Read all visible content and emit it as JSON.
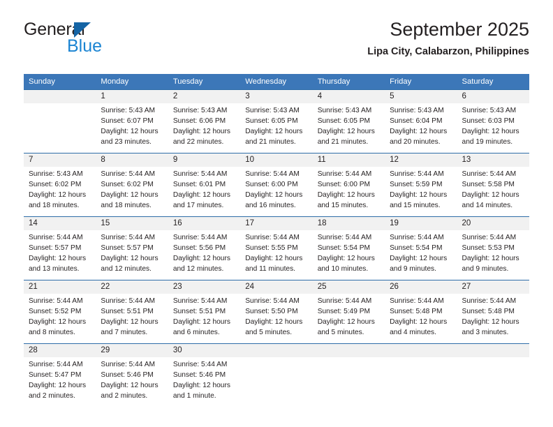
{
  "brand": {
    "name_dark": "General",
    "name_blue": "Blue",
    "accent_blue": "#1b84d2",
    "triangle_blue": "#1464a5"
  },
  "header": {
    "title": "September 2025",
    "subtitle": "Lipa City, Calabarzon, Philippines"
  },
  "calendar": {
    "header_bg": "#3c77b8",
    "daynum_bg": "#f1f1f1",
    "weekdays": [
      "Sunday",
      "Monday",
      "Tuesday",
      "Wednesday",
      "Thursday",
      "Friday",
      "Saturday"
    ],
    "weeks": [
      [
        {
          "day": "",
          "sunrise": "",
          "sunset": "",
          "daylight1": "",
          "daylight2": ""
        },
        {
          "day": "1",
          "sunrise": "Sunrise: 5:43 AM",
          "sunset": "Sunset: 6:07 PM",
          "daylight1": "Daylight: 12 hours",
          "daylight2": "and 23 minutes."
        },
        {
          "day": "2",
          "sunrise": "Sunrise: 5:43 AM",
          "sunset": "Sunset: 6:06 PM",
          "daylight1": "Daylight: 12 hours",
          "daylight2": "and 22 minutes."
        },
        {
          "day": "3",
          "sunrise": "Sunrise: 5:43 AM",
          "sunset": "Sunset: 6:05 PM",
          "daylight1": "Daylight: 12 hours",
          "daylight2": "and 21 minutes."
        },
        {
          "day": "4",
          "sunrise": "Sunrise: 5:43 AM",
          "sunset": "Sunset: 6:05 PM",
          "daylight1": "Daylight: 12 hours",
          "daylight2": "and 21 minutes."
        },
        {
          "day": "5",
          "sunrise": "Sunrise: 5:43 AM",
          "sunset": "Sunset: 6:04 PM",
          "daylight1": "Daylight: 12 hours",
          "daylight2": "and 20 minutes."
        },
        {
          "day": "6",
          "sunrise": "Sunrise: 5:43 AM",
          "sunset": "Sunset: 6:03 PM",
          "daylight1": "Daylight: 12 hours",
          "daylight2": "and 19 minutes."
        }
      ],
      [
        {
          "day": "7",
          "sunrise": "Sunrise: 5:43 AM",
          "sunset": "Sunset: 6:02 PM",
          "daylight1": "Daylight: 12 hours",
          "daylight2": "and 18 minutes."
        },
        {
          "day": "8",
          "sunrise": "Sunrise: 5:44 AM",
          "sunset": "Sunset: 6:02 PM",
          "daylight1": "Daylight: 12 hours",
          "daylight2": "and 18 minutes."
        },
        {
          "day": "9",
          "sunrise": "Sunrise: 5:44 AM",
          "sunset": "Sunset: 6:01 PM",
          "daylight1": "Daylight: 12 hours",
          "daylight2": "and 17 minutes."
        },
        {
          "day": "10",
          "sunrise": "Sunrise: 5:44 AM",
          "sunset": "Sunset: 6:00 PM",
          "daylight1": "Daylight: 12 hours",
          "daylight2": "and 16 minutes."
        },
        {
          "day": "11",
          "sunrise": "Sunrise: 5:44 AM",
          "sunset": "Sunset: 6:00 PM",
          "daylight1": "Daylight: 12 hours",
          "daylight2": "and 15 minutes."
        },
        {
          "day": "12",
          "sunrise": "Sunrise: 5:44 AM",
          "sunset": "Sunset: 5:59 PM",
          "daylight1": "Daylight: 12 hours",
          "daylight2": "and 15 minutes."
        },
        {
          "day": "13",
          "sunrise": "Sunrise: 5:44 AM",
          "sunset": "Sunset: 5:58 PM",
          "daylight1": "Daylight: 12 hours",
          "daylight2": "and 14 minutes."
        }
      ],
      [
        {
          "day": "14",
          "sunrise": "Sunrise: 5:44 AM",
          "sunset": "Sunset: 5:57 PM",
          "daylight1": "Daylight: 12 hours",
          "daylight2": "and 13 minutes."
        },
        {
          "day": "15",
          "sunrise": "Sunrise: 5:44 AM",
          "sunset": "Sunset: 5:57 PM",
          "daylight1": "Daylight: 12 hours",
          "daylight2": "and 12 minutes."
        },
        {
          "day": "16",
          "sunrise": "Sunrise: 5:44 AM",
          "sunset": "Sunset: 5:56 PM",
          "daylight1": "Daylight: 12 hours",
          "daylight2": "and 12 minutes."
        },
        {
          "day": "17",
          "sunrise": "Sunrise: 5:44 AM",
          "sunset": "Sunset: 5:55 PM",
          "daylight1": "Daylight: 12 hours",
          "daylight2": "and 11 minutes."
        },
        {
          "day": "18",
          "sunrise": "Sunrise: 5:44 AM",
          "sunset": "Sunset: 5:54 PM",
          "daylight1": "Daylight: 12 hours",
          "daylight2": "and 10 minutes."
        },
        {
          "day": "19",
          "sunrise": "Sunrise: 5:44 AM",
          "sunset": "Sunset: 5:54 PM",
          "daylight1": "Daylight: 12 hours",
          "daylight2": "and 9 minutes."
        },
        {
          "day": "20",
          "sunrise": "Sunrise: 5:44 AM",
          "sunset": "Sunset: 5:53 PM",
          "daylight1": "Daylight: 12 hours",
          "daylight2": "and 9 minutes."
        }
      ],
      [
        {
          "day": "21",
          "sunrise": "Sunrise: 5:44 AM",
          "sunset": "Sunset: 5:52 PM",
          "daylight1": "Daylight: 12 hours",
          "daylight2": "and 8 minutes."
        },
        {
          "day": "22",
          "sunrise": "Sunrise: 5:44 AM",
          "sunset": "Sunset: 5:51 PM",
          "daylight1": "Daylight: 12 hours",
          "daylight2": "and 7 minutes."
        },
        {
          "day": "23",
          "sunrise": "Sunrise: 5:44 AM",
          "sunset": "Sunset: 5:51 PM",
          "daylight1": "Daylight: 12 hours",
          "daylight2": "and 6 minutes."
        },
        {
          "day": "24",
          "sunrise": "Sunrise: 5:44 AM",
          "sunset": "Sunset: 5:50 PM",
          "daylight1": "Daylight: 12 hours",
          "daylight2": "and 5 minutes."
        },
        {
          "day": "25",
          "sunrise": "Sunrise: 5:44 AM",
          "sunset": "Sunset: 5:49 PM",
          "daylight1": "Daylight: 12 hours",
          "daylight2": "and 5 minutes."
        },
        {
          "day": "26",
          "sunrise": "Sunrise: 5:44 AM",
          "sunset": "Sunset: 5:48 PM",
          "daylight1": "Daylight: 12 hours",
          "daylight2": "and 4 minutes."
        },
        {
          "day": "27",
          "sunrise": "Sunrise: 5:44 AM",
          "sunset": "Sunset: 5:48 PM",
          "daylight1": "Daylight: 12 hours",
          "daylight2": "and 3 minutes."
        }
      ],
      [
        {
          "day": "28",
          "sunrise": "Sunrise: 5:44 AM",
          "sunset": "Sunset: 5:47 PM",
          "daylight1": "Daylight: 12 hours",
          "daylight2": "and 2 minutes."
        },
        {
          "day": "29",
          "sunrise": "Sunrise: 5:44 AM",
          "sunset": "Sunset: 5:46 PM",
          "daylight1": "Daylight: 12 hours",
          "daylight2": "and 2 minutes."
        },
        {
          "day": "30",
          "sunrise": "Sunrise: 5:44 AM",
          "sunset": "Sunset: 5:46 PM",
          "daylight1": "Daylight: 12 hours",
          "daylight2": "and 1 minute."
        },
        {
          "day": "",
          "sunrise": "",
          "sunset": "",
          "daylight1": "",
          "daylight2": ""
        },
        {
          "day": "",
          "sunrise": "",
          "sunset": "",
          "daylight1": "",
          "daylight2": ""
        },
        {
          "day": "",
          "sunrise": "",
          "sunset": "",
          "daylight1": "",
          "daylight2": ""
        },
        {
          "day": "",
          "sunrise": "",
          "sunset": "",
          "daylight1": "",
          "daylight2": ""
        }
      ]
    ]
  }
}
